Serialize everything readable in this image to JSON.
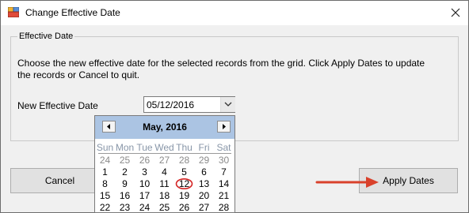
{
  "window": {
    "title": "Change Effective Date"
  },
  "group": {
    "legend": "Effective Date",
    "description": "Choose the new effective date for the selected records from the grid.  Click Apply Dates to update the records or Cancel to quit.",
    "date_label": "New Effective Date",
    "date_value": "05/12/2016"
  },
  "buttons": {
    "cancel": "Cancel",
    "apply": "Apply Dates"
  },
  "calendar": {
    "month_label": "May, 2016",
    "weekdays": [
      "Sun",
      "Mon",
      "Tue",
      "Wed",
      "Thu",
      "Fri",
      "Sat"
    ],
    "weeks": [
      [
        "24",
        "25",
        "26",
        "27",
        "28",
        "29",
        "30"
      ],
      [
        "1",
        "2",
        "3",
        "4",
        "5",
        "6",
        "7"
      ],
      [
        "8",
        "9",
        "10",
        "11",
        "12",
        "13",
        "14"
      ],
      [
        "15",
        "16",
        "17",
        "18",
        "19",
        "20",
        "21"
      ],
      [
        "22",
        "23",
        "24",
        "25",
        "26",
        "27",
        "28"
      ]
    ],
    "selected_day": "12",
    "colors": {
      "header": "#abc4e3",
      "weekday_text": "#8896a8",
      "today_circle": "#d42424"
    }
  },
  "annotation": {
    "arrow_color": "#d9412b"
  },
  "icons": {
    "app": "app-icon",
    "close": "close-icon",
    "prev": "chevron-left-icon",
    "next": "chevron-right-icon",
    "dropdown": "chevron-down-icon"
  }
}
